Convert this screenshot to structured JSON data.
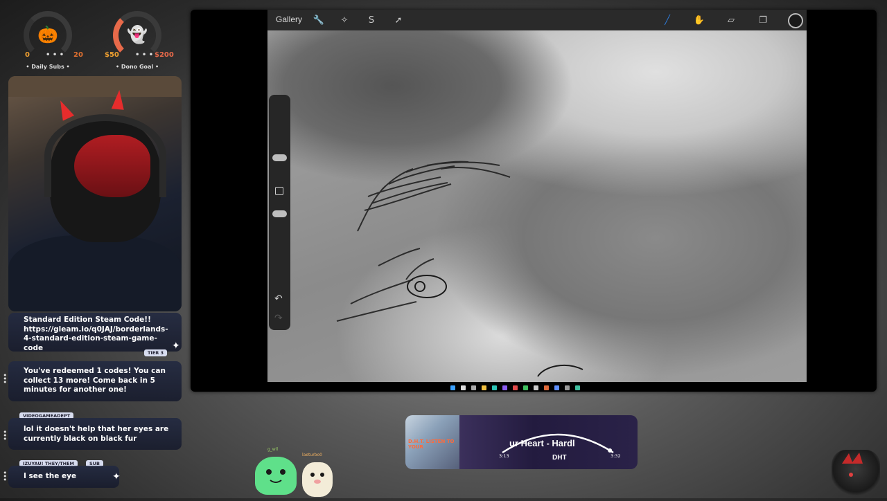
{
  "goals": {
    "subs": {
      "icon": "pumpkin-icon",
      "glyph": "🎃",
      "min": "0",
      "dots": "• • •",
      "max": "20",
      "label": "• Daily Subs •"
    },
    "dono": {
      "icon": "ghost-icon",
      "glyph": "👻",
      "min": "$50",
      "dots": "• • •",
      "max": "$200",
      "label": "• Dono Goal •"
    }
  },
  "chat": {
    "msg1": "Standard Edition Steam Code!! https://gleam.io/q0JAJ/borderlands-4-standard-edition-steam-game-code",
    "msg1_tag": "TIER 3",
    "msg2": "You've redeemed 1 codes! You can collect 13 more! Come back in 5 minutes for another one!",
    "msg3_user": "VIDEOGAMEADEPT",
    "msg3": "lol it doesn't help that her eyes are currently black on black fur",
    "msg4_user": "IZUYAU! THEY/THEM",
    "msg4_badge": "SUB",
    "msg4": "I see the eye"
  },
  "procreate": {
    "gallery": "Gallery",
    "left_tools": [
      "wrench-icon",
      "magic-wand-icon",
      "selection-icon",
      "transform-arrow-icon"
    ],
    "right_tools": [
      "brush-icon",
      "smudge-icon",
      "eraser-icon",
      "layers-icon",
      "color-swatch-icon"
    ],
    "colors": {
      "accent": "#2f7bd8",
      "swatch": "#1a1a1a"
    }
  },
  "music": {
    "album_text": "D.H.T. LISTEN TO YOUR",
    "title": "ur Heart - Hardl",
    "artist": "DHT",
    "elapsed": "3:13",
    "total": "3:32",
    "progress": 0.97
  },
  "mascots": {
    "green_name": "g_wll",
    "deer_name": "laeturbo0"
  }
}
